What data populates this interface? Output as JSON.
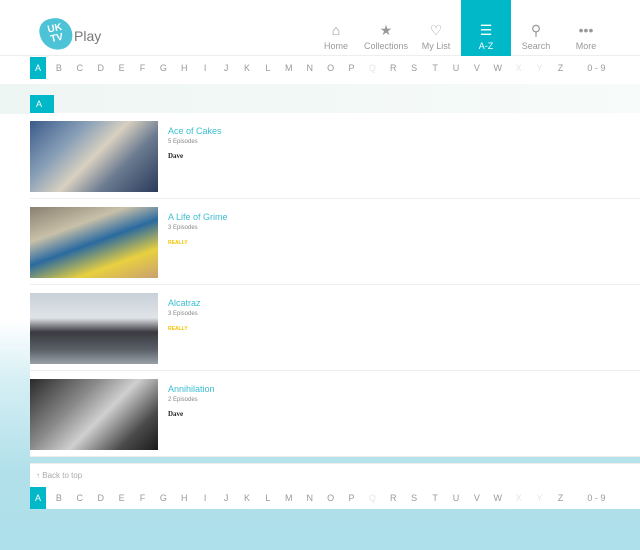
{
  "header": {
    "logo_text": "UKTV Play",
    "logo_mark": "UK TV",
    "logo_word": "Play",
    "nav": [
      {
        "icon": "home-icon",
        "glyph": "⌂",
        "label": "Home"
      },
      {
        "icon": "collections-icon",
        "glyph": "★",
        "label": "Collections"
      },
      {
        "icon": "heart-icon",
        "glyph": "♡",
        "label": "My List"
      },
      {
        "icon": "list-icon",
        "glyph": "☰",
        "label": "A-Z",
        "active": true
      },
      {
        "icon": "search-icon",
        "glyph": "⚲",
        "label": "Search"
      },
      {
        "icon": "more-icon",
        "glyph": "•••",
        "label": "More"
      }
    ]
  },
  "alphabet": [
    "A",
    "B",
    "C",
    "D",
    "E",
    "F",
    "G",
    "H",
    "I",
    "J",
    "K",
    "L",
    "M",
    "N",
    "O",
    "P",
    "Q",
    "R",
    "S",
    "T",
    "U",
    "V",
    "W",
    "X",
    "Y",
    "Z",
    "0 - 9"
  ],
  "disabled_letters": [
    "Q",
    "X",
    "Y"
  ],
  "active_letter": "A",
  "section": {
    "label": "A"
  },
  "shows": [
    {
      "title": "Ace of Cakes",
      "episodes": "5 Episodes",
      "channel": "Dave"
    },
    {
      "title": "A Life of Grime",
      "episodes": "3 Episodes",
      "channel": "REALLY"
    },
    {
      "title": "Alcatraz",
      "episodes": "3 Episodes",
      "channel": "REALLY"
    },
    {
      "title": "Annihilation",
      "episodes": "2 Episodes",
      "channel": "Dave"
    }
  ],
  "back_to_top": "Back to top",
  "colors": {
    "accent": "#00b8c8",
    "title": "#3bbfd0",
    "really": "#f5c400"
  }
}
